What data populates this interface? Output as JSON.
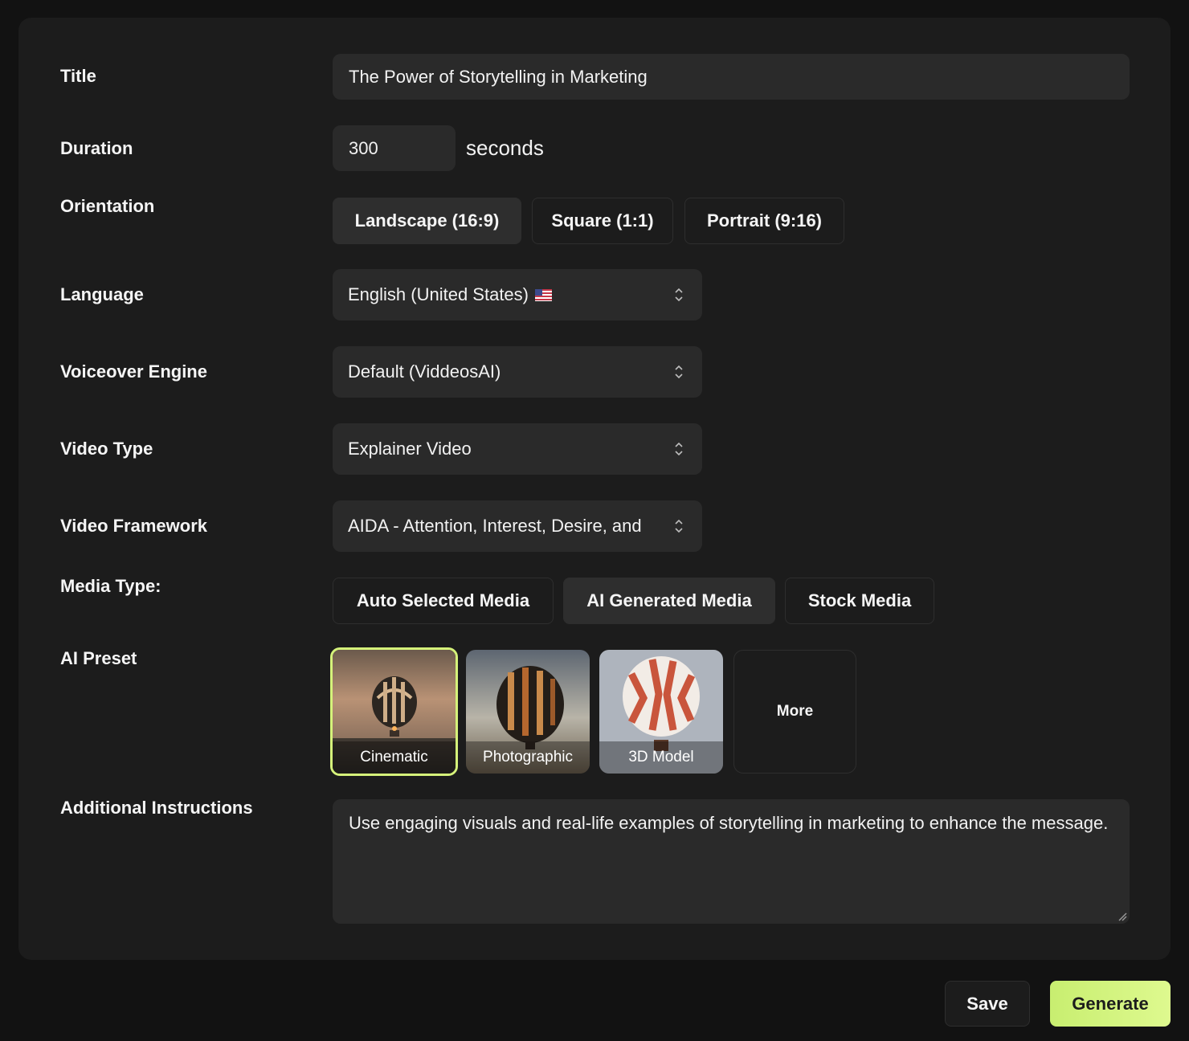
{
  "form": {
    "title_label": "Title",
    "title_value": "The Power of Storytelling in Marketing",
    "duration_label": "Duration",
    "duration_value": "300",
    "duration_unit": "seconds",
    "orientation_label": "Orientation",
    "orientation_options": [
      "Landscape (16:9)",
      "Square (1:1)",
      "Portrait (9:16)"
    ],
    "orientation_selected": "Landscape (16:9)",
    "language_label": "Language",
    "language_value": "English (United States)",
    "language_flag_icon": "us-flag-icon",
    "voiceover_label": "Voiceover Engine",
    "voiceover_value": "Default (ViddeosAI)",
    "video_type_label": "Video Type",
    "video_type_value": "Explainer Video",
    "framework_label": "Video Framework",
    "framework_value": "AIDA - Attention, Interest, Desire, and",
    "media_type_label": "Media Type:",
    "media_type_options": [
      "Auto Selected Media",
      "AI Generated Media",
      "Stock Media"
    ],
    "media_type_selected": "AI Generated Media",
    "ai_preset_label": "AI Preset",
    "ai_presets": [
      "Cinematic",
      "Photographic",
      "3D Model"
    ],
    "ai_preset_selected": "Cinematic",
    "ai_preset_more": "More",
    "instructions_label": "Additional Instructions",
    "instructions_value": "Use engaging visuals and real-life examples of storytelling in marketing to enhance the message."
  },
  "actions": {
    "save_label": "Save",
    "generate_label": "Generate"
  },
  "colors": {
    "page_bg": "#121212",
    "panel_bg": "#1c1c1c",
    "field_bg": "#2a2a2a",
    "accent": "#d5f27a"
  }
}
